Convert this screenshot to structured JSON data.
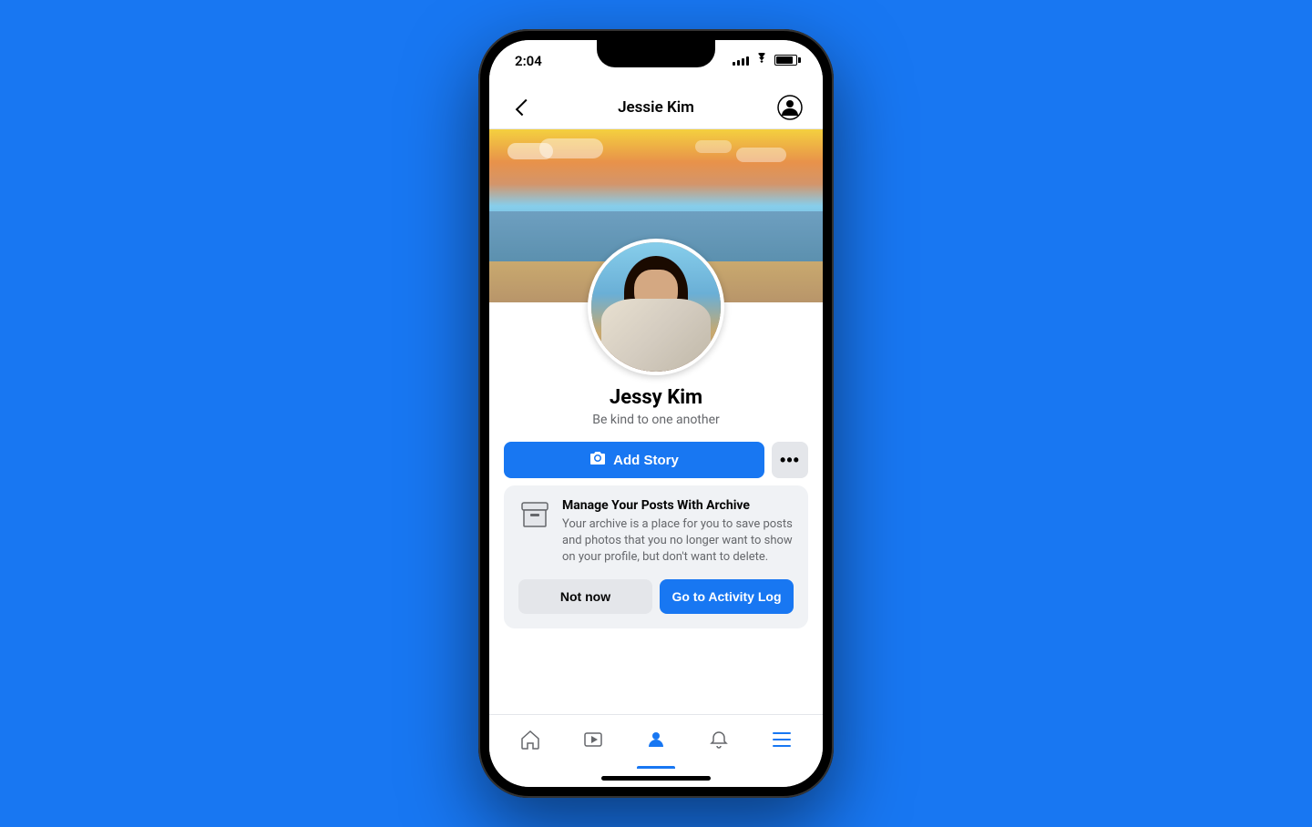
{
  "background_color": "#1877F2",
  "status_bar": {
    "time": "2:04"
  },
  "header": {
    "title": "Jessie Kim",
    "back_label": "back",
    "profile_icon_label": "profile-settings"
  },
  "profile": {
    "name": "Jessy Kim",
    "bio": "Be kind to one another"
  },
  "buttons": {
    "add_story": "Add Story",
    "more": "...",
    "not_now": "Not now",
    "activity_log": "Go to Activity Log"
  },
  "archive_banner": {
    "title": "Manage Your Posts With Archive",
    "description": "Your archive is a place for you to save posts and photos that you no longer want to show on your profile, but don't want to delete."
  },
  "bottom_nav": {
    "items": [
      {
        "id": "home",
        "label": "Home",
        "active": false
      },
      {
        "id": "watch",
        "label": "Watch",
        "active": false
      },
      {
        "id": "profile",
        "label": "Profile",
        "active": true
      },
      {
        "id": "notifications",
        "label": "Notifications",
        "active": false
      },
      {
        "id": "menu",
        "label": "Menu",
        "active": false
      }
    ]
  }
}
